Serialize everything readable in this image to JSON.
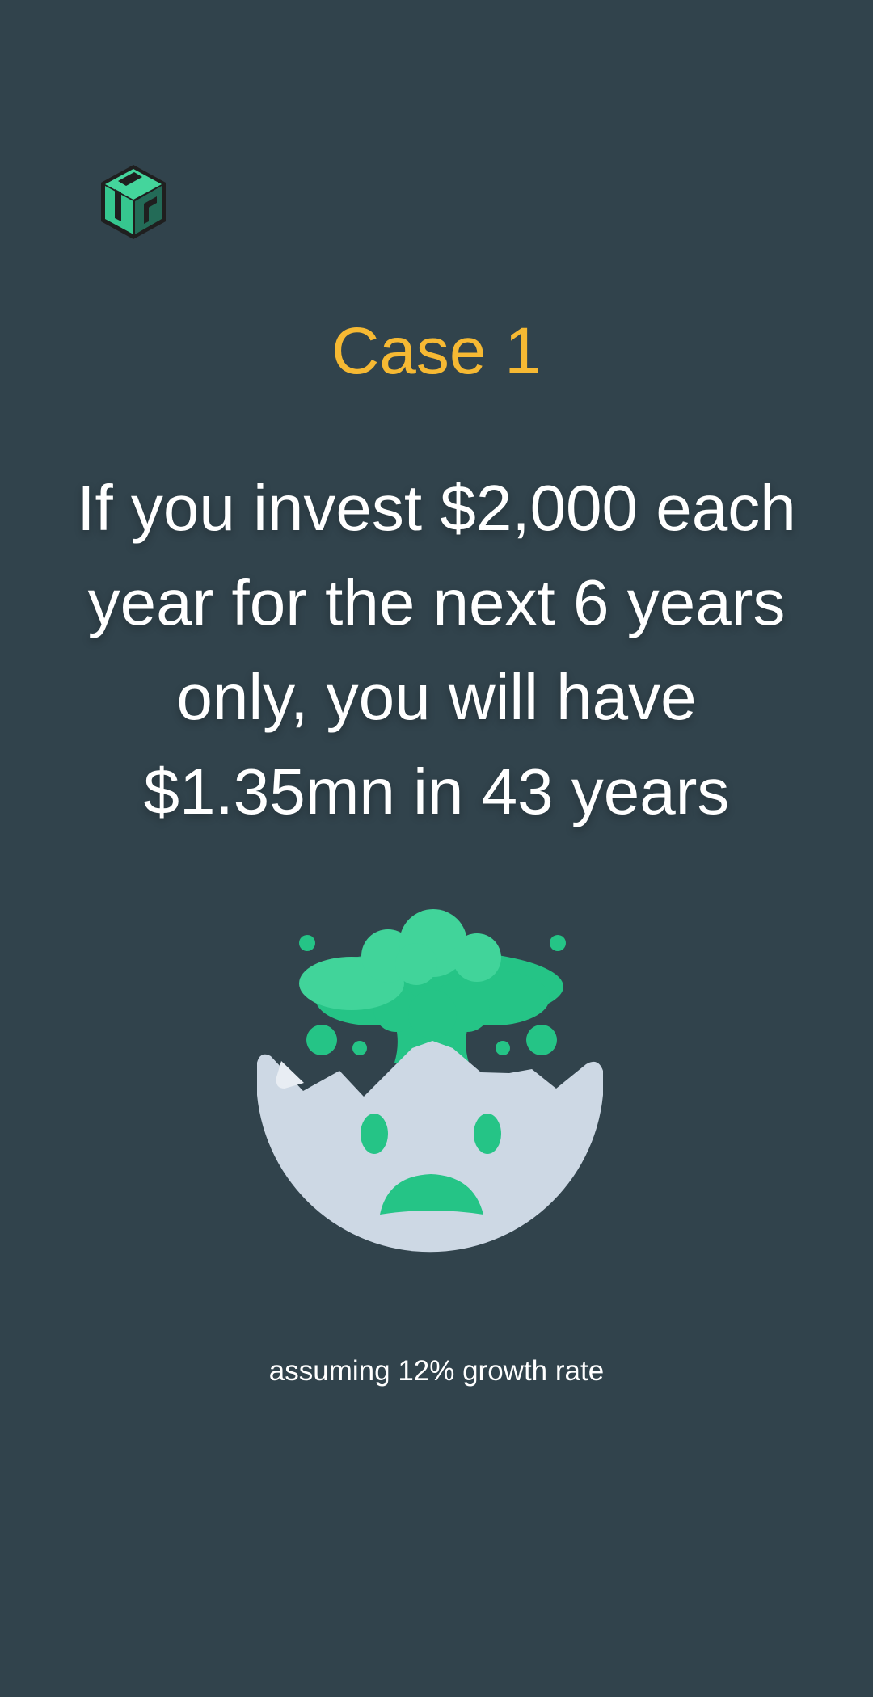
{
  "header": {
    "logo_icon": "cube-logo-icon",
    "title": "Case 1"
  },
  "main": {
    "headline": "If you invest $2,000 each year for the next 6 years only, you will have $1.35mn in 43 years",
    "illustration_icon": "exploding-head-icon",
    "footnote": "assuming  12% growth rate"
  },
  "colors": {
    "background": "#31434c",
    "accent": "#f6b933",
    "green": "#25c486",
    "green_light": "#41d49a",
    "face": "#cdd8e4",
    "text": "#ffffff"
  }
}
